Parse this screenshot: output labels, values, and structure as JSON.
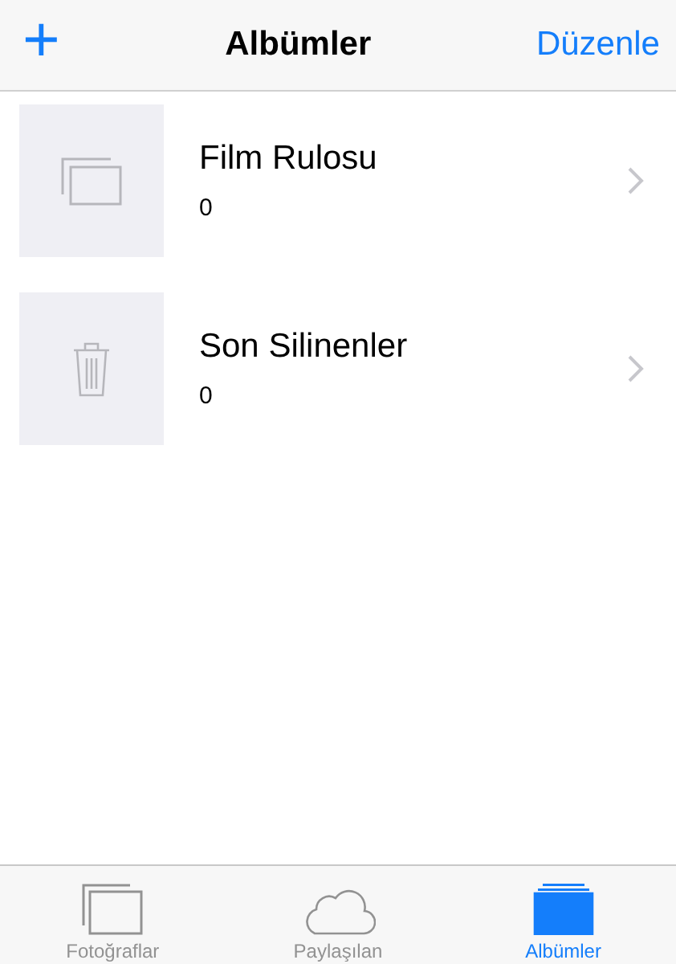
{
  "nav": {
    "add": "+",
    "title": "Albümler",
    "edit": "Düzenle"
  },
  "albums": [
    {
      "kind": "photos",
      "name": "Film Rulosu",
      "count": "0"
    },
    {
      "kind": "trash",
      "name": "Son Silinenler",
      "count": "0"
    }
  ],
  "tabs": [
    {
      "kind": "photos",
      "label": "Fotoğraflar",
      "selected": false
    },
    {
      "kind": "cloud",
      "label": "Paylaşılan",
      "selected": false
    },
    {
      "kind": "albums",
      "label": "Albümler",
      "selected": true
    }
  ]
}
